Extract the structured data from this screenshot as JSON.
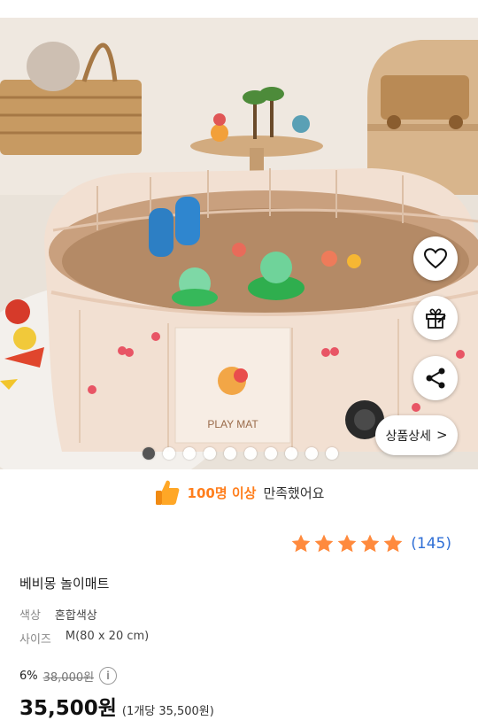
{
  "hero": {
    "image_label": "PLAY MAT",
    "slide_count": 10,
    "active_slide": 0
  },
  "actions": {
    "like_icon": "heart-icon",
    "gift_icon": "gift-icon",
    "share_icon": "share-icon",
    "detail_label": "상품상세",
    "detail_chevron": ">"
  },
  "satisfaction": {
    "count_text": "100명 이상",
    "message": "만족했어요",
    "icon": "thumbs-up-icon"
  },
  "rating": {
    "stars": 5,
    "review_count": "(145)",
    "star_color": "#ff8a3d"
  },
  "product": {
    "name": "베비몽 놀이매트",
    "color_label": "색상",
    "color_value": "혼합색상",
    "size_label": "사이즈",
    "size_value": "M(80 x 20 cm)",
    "discount": "6%",
    "original_price": "38,000원",
    "price": "35,500원",
    "unit_price": "(1개당 35,500원)"
  },
  "colors": {
    "accent": "#ff7e1c",
    "link": "#2f6fd6"
  }
}
